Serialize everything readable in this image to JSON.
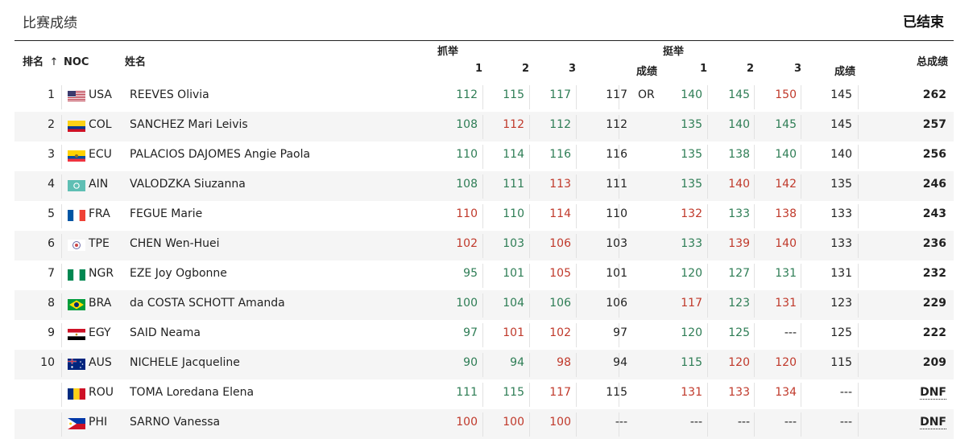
{
  "header": {
    "title": "比赛成绩",
    "status": "已结束"
  },
  "columns": {
    "rank": "排名",
    "sort_arrow": "↑",
    "noc": "NOC",
    "name": "姓名",
    "snatch": "抓举",
    "snatch_1": "1",
    "snatch_2": "2",
    "snatch_3": "3",
    "cj": "挺举",
    "snatch_result": "成绩",
    "cj_1": "1",
    "cj_2": "2",
    "cj_3": "3",
    "cj_result": "成绩",
    "total": "总成绩"
  },
  "colors": {
    "good_lift": "#2e7d55",
    "no_lift": "#c0392b"
  },
  "rows": [
    {
      "rank": "1",
      "noc": "USA",
      "flag": "usa-flag",
      "name": "REEVES Olivia",
      "s1": "112",
      "s1_ok": true,
      "s2": "115",
      "s2_ok": true,
      "s3": "117",
      "s3_ok": true,
      "sres": "117",
      "note": "OR",
      "c1": "140",
      "c1_ok": true,
      "c2": "145",
      "c2_ok": true,
      "c3": "150",
      "c3_ok": false,
      "cres": "145",
      "total": "262"
    },
    {
      "rank": "2",
      "noc": "COL",
      "flag": "col-flag",
      "name": "SANCHEZ Mari Leivis",
      "s1": "108",
      "s1_ok": true,
      "s2": "112",
      "s2_ok": false,
      "s3": "112",
      "s3_ok": true,
      "sres": "112",
      "note": "",
      "c1": "135",
      "c1_ok": true,
      "c2": "140",
      "c2_ok": true,
      "c3": "145",
      "c3_ok": true,
      "cres": "145",
      "total": "257"
    },
    {
      "rank": "3",
      "noc": "ECU",
      "flag": "ecu-flag",
      "name": "PALACIOS DAJOMES Angie Paola",
      "s1": "110",
      "s1_ok": true,
      "s2": "114",
      "s2_ok": true,
      "s3": "116",
      "s3_ok": true,
      "sres": "116",
      "note": "",
      "c1": "135",
      "c1_ok": true,
      "c2": "138",
      "c2_ok": true,
      "c3": "140",
      "c3_ok": true,
      "cres": "140",
      "total": "256"
    },
    {
      "rank": "4",
      "noc": "AIN",
      "flag": "ain-flag",
      "name": "VALODZKA Siuzanna",
      "s1": "108",
      "s1_ok": true,
      "s2": "111",
      "s2_ok": true,
      "s3": "113",
      "s3_ok": false,
      "sres": "111",
      "note": "",
      "c1": "135",
      "c1_ok": true,
      "c2": "140",
      "c2_ok": false,
      "c3": "142",
      "c3_ok": false,
      "cres": "135",
      "total": "246"
    },
    {
      "rank": "5",
      "noc": "FRA",
      "flag": "fra-flag",
      "name": "FEGUE Marie",
      "s1": "110",
      "s1_ok": false,
      "s2": "110",
      "s2_ok": true,
      "s3": "114",
      "s3_ok": false,
      "sres": "110",
      "note": "",
      "c1": "132",
      "c1_ok": false,
      "c2": "133",
      "c2_ok": true,
      "c3": "138",
      "c3_ok": false,
      "cres": "133",
      "total": "243"
    },
    {
      "rank": "6",
      "noc": "TPE",
      "flag": "tpe-flag",
      "name": "CHEN Wen-Huei",
      "s1": "102",
      "s1_ok": false,
      "s2": "103",
      "s2_ok": true,
      "s3": "106",
      "s3_ok": false,
      "sres": "103",
      "note": "",
      "c1": "133",
      "c1_ok": true,
      "c2": "139",
      "c2_ok": false,
      "c3": "140",
      "c3_ok": false,
      "cres": "133",
      "total": "236"
    },
    {
      "rank": "7",
      "noc": "NGR",
      "flag": "ngr-flag",
      "name": "EZE Joy Ogbonne",
      "s1": "95",
      "s1_ok": true,
      "s2": "101",
      "s2_ok": true,
      "s3": "105",
      "s3_ok": false,
      "sres": "101",
      "note": "",
      "c1": "120",
      "c1_ok": true,
      "c2": "127",
      "c2_ok": true,
      "c3": "131",
      "c3_ok": true,
      "cres": "131",
      "total": "232"
    },
    {
      "rank": "8",
      "noc": "BRA",
      "flag": "bra-flag",
      "name": "da COSTA SCHOTT Amanda",
      "s1": "100",
      "s1_ok": true,
      "s2": "104",
      "s2_ok": true,
      "s3": "106",
      "s3_ok": true,
      "sres": "106",
      "note": "",
      "c1": "117",
      "c1_ok": false,
      "c2": "123",
      "c2_ok": true,
      "c3": "131",
      "c3_ok": false,
      "cres": "123",
      "total": "229"
    },
    {
      "rank": "9",
      "noc": "EGY",
      "flag": "egy-flag",
      "name": "SAID Neama",
      "s1": "97",
      "s1_ok": true,
      "s2": "101",
      "s2_ok": false,
      "s3": "102",
      "s3_ok": false,
      "sres": "97",
      "note": "",
      "c1": "120",
      "c1_ok": true,
      "c2": "125",
      "c2_ok": true,
      "c3": "---",
      "c3_ok": null,
      "cres": "125",
      "total": "222"
    },
    {
      "rank": "10",
      "noc": "AUS",
      "flag": "aus-flag",
      "name": "NICHELE Jacqueline",
      "s1": "90",
      "s1_ok": true,
      "s2": "94",
      "s2_ok": true,
      "s3": "98",
      "s3_ok": false,
      "sres": "94",
      "note": "",
      "c1": "115",
      "c1_ok": true,
      "c2": "120",
      "c2_ok": false,
      "c3": "120",
      "c3_ok": false,
      "cres": "115",
      "total": "209"
    },
    {
      "rank": "",
      "noc": "ROU",
      "flag": "rou-flag",
      "name": "TOMA Loredana Elena",
      "s1": "111",
      "s1_ok": true,
      "s2": "115",
      "s2_ok": true,
      "s3": "117",
      "s3_ok": false,
      "sres": "115",
      "note": "",
      "c1": "131",
      "c1_ok": false,
      "c2": "133",
      "c2_ok": false,
      "c3": "134",
      "c3_ok": false,
      "cres": "---",
      "total": "DNF"
    },
    {
      "rank": "",
      "noc": "PHI",
      "flag": "phi-flag",
      "name": "SARNO Vanessa",
      "s1": "100",
      "s1_ok": false,
      "s2": "100",
      "s2_ok": false,
      "s3": "100",
      "s3_ok": false,
      "sres": "---",
      "note": "",
      "c1": "---",
      "c1_ok": null,
      "c2": "---",
      "c2_ok": null,
      "c3": "---",
      "c3_ok": null,
      "cres": "---",
      "total": "DNF"
    }
  ]
}
